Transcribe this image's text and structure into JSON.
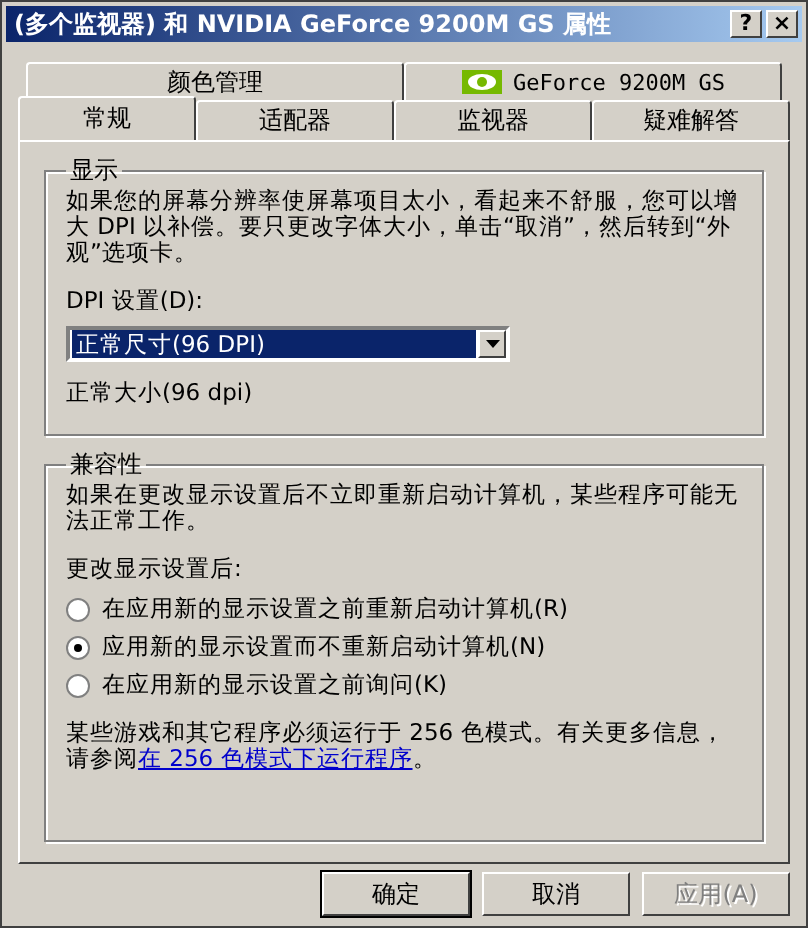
{
  "window": {
    "title": "(多个监视器) 和 NVIDIA GeForce 9200M GS 属性"
  },
  "title_buttons": [
    "?",
    "×"
  ],
  "tab_rows": [
    [
      {
        "label": "颜色管理",
        "selected": false,
        "icon": false
      },
      {
        "label": "GeForce 9200M GS",
        "selected": false,
        "icon": true
      }
    ],
    [
      {
        "label": "常规",
        "selected": true,
        "icon": false
      },
      {
        "label": "适配器",
        "selected": false,
        "icon": false
      },
      {
        "label": "监视器",
        "selected": false,
        "icon": false
      },
      {
        "label": "疑难解答",
        "selected": false,
        "icon": false
      }
    ]
  ],
  "display_group": {
    "title": "显示",
    "description": "如果您的屏幕分辨率使屏幕项目太小，看起来不舒服，您可以增大 DPI 以补偿。要只更改字体大小，单击“取消”，然后转到“外观”选项卡。",
    "dpi_label": "DPI 设置(D):",
    "dpi_value": "正常尺寸(96 DPI)",
    "dpi_note": "正常大小(96 dpi)"
  },
  "compat_group": {
    "title": "兼容性",
    "description": "如果在更改显示设置后不立即重新启动计算机，某些程序可能无法正常工作。",
    "prompt": "更改显示设置后:",
    "options": [
      {
        "label": "在应用新的显示设置之前重新启动计算机(R)",
        "selected": false
      },
      {
        "label": "应用新的显示设置而不重新启动计算机(N)",
        "selected": true
      },
      {
        "label": "在应用新的显示设置之前询问(K)",
        "selected": false
      }
    ],
    "note": "某些游戏和其它程序必须运行于 256 色模式。有关更多信息，请参阅",
    "note_link": "在 256 色模式下运行程序",
    "note_end": "。"
  },
  "buttons": [
    {
      "label": "确定",
      "default": true,
      "disabled": false
    },
    {
      "label": "取消",
      "default": false,
      "disabled": false
    },
    {
      "label": "应用(A)",
      "default": false,
      "disabled": true
    }
  ]
}
